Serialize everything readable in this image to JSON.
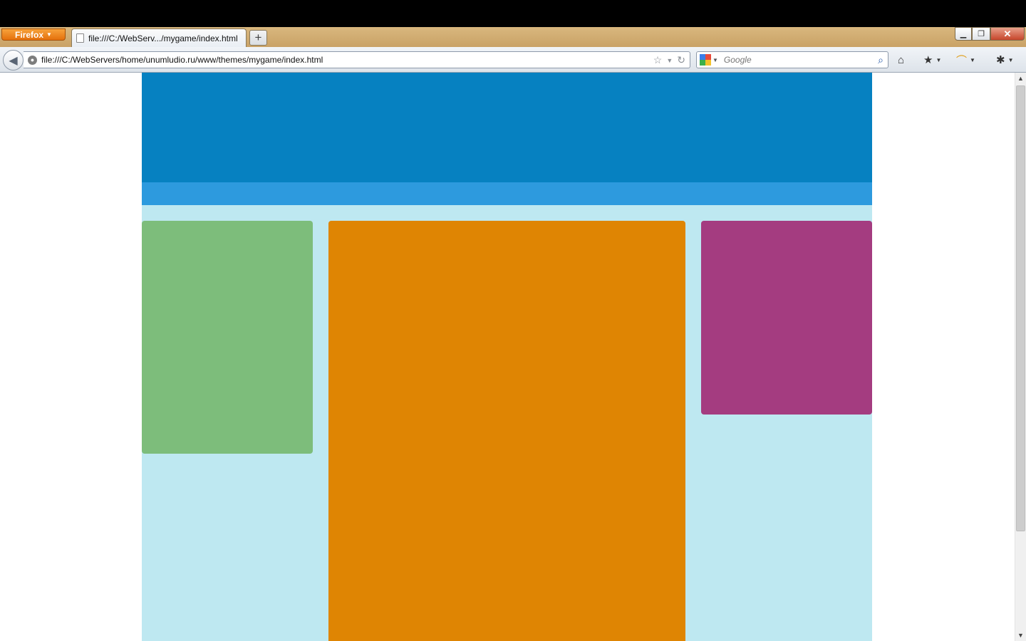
{
  "browser": {
    "app_button_label": "Firefox",
    "tab": {
      "title": "file:///C:/WebServ.../mygame/index.html"
    },
    "new_tab_label": "+",
    "address": {
      "url": "file:///C:/WebServers/home/unumludio.ru/www/themes/mygame/index.html"
    },
    "search": {
      "placeholder": "Google"
    }
  },
  "page": {
    "colors": {
      "page_background": "#bee8f1",
      "header": "#0681c1",
      "nav_strip": "#2d9ade",
      "left_column": "#7dbd7b",
      "center_column": "#df8503",
      "right_column": "#a43c80"
    }
  }
}
